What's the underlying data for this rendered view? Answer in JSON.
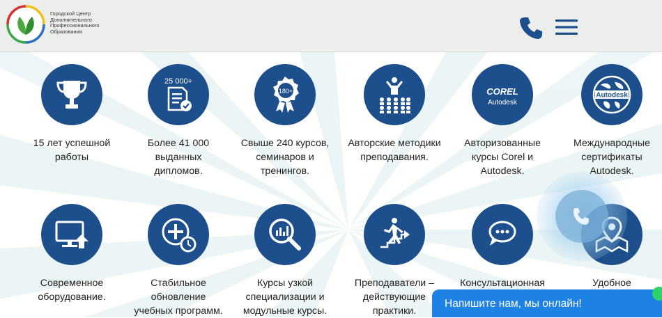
{
  "header": {
    "logo_lines": [
      "Городской Центр",
      "Дополнительного",
      "Профессионального",
      "Образования"
    ],
    "phone_icon": "phone-icon",
    "menu_icon": "hamburger-menu-icon"
  },
  "features": [
    {
      "icon": "trophy-icon",
      "lines": [
        "15 лет успешной",
        "работы"
      ]
    },
    {
      "icon": "diploma-document-icon",
      "icon_text": "25 000+",
      "lines": [
        "Более 41 000",
        "выданных",
        "дипломов."
      ]
    },
    {
      "icon": "award-badge-icon",
      "icon_text": "180+",
      "lines": [
        "Свыше 240 курсов,",
        "семинаров и",
        "тренингов."
      ]
    },
    {
      "icon": "audience-presenter-icon",
      "lines": [
        "Авторские методики",
        "преподавания."
      ]
    },
    {
      "icon": "corel-autodesk-logo-icon",
      "icon_text": "COREL",
      "icon_text2": "Autodesk",
      "lines": [
        "Авторизованные",
        "курсы Corel и",
        "Autodesk."
      ]
    },
    {
      "icon": "autodesk-globe-icon",
      "icon_text": "Autodesk",
      "lines": [
        "Международные",
        "сертификаты",
        "Autodesk."
      ]
    },
    {
      "icon": "computer-monitor-icon",
      "lines": [
        "Современное",
        "оборудование."
      ]
    },
    {
      "icon": "plus-clock-icon",
      "lines": [
        "Стабильное",
        "обновление",
        "учебных программ."
      ]
    },
    {
      "icon": "magnifier-chart-icon",
      "lines": [
        "Курсы узкой",
        "специализации и",
        "модульные курсы."
      ]
    },
    {
      "icon": "running-man-arrow-icon",
      "lines": [
        "Преподаватели –",
        "действующие",
        "практики."
      ]
    },
    {
      "icon": "chat-bubbles-icon",
      "lines": [
        "Консультационная"
      ]
    },
    {
      "icon": "map-pin-icon",
      "lines": [
        "Удобное"
      ]
    }
  ],
  "chat": {
    "label": "Напишите нам, мы онлайн!"
  },
  "colors": {
    "circle": "#1d4f8c",
    "header_bg": "#eceeec",
    "chat_bg": "#1e82e5",
    "chat_dot": "#2bd36b"
  }
}
